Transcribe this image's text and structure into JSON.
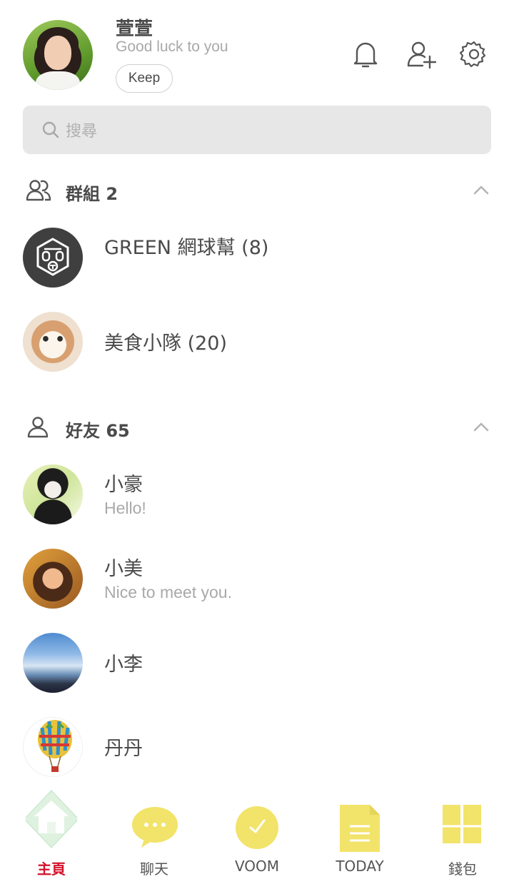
{
  "profile": {
    "name": "萱萱",
    "status_message": "Good luck to you",
    "keep_label": "Keep"
  },
  "header_icons": [
    "bell-icon",
    "add-friend-icon",
    "settings-gear-icon"
  ],
  "search": {
    "placeholder": "搜尋"
  },
  "groups": {
    "title": "群組 2",
    "items": [
      {
        "name": "GREEN 網球幫 (8)"
      },
      {
        "name": "美食小隊 (20)"
      }
    ]
  },
  "friends": {
    "title": "好友 65",
    "items": [
      {
        "name": "小豪",
        "status": "Hello!"
      },
      {
        "name": "小美",
        "status": "Nice to meet you."
      },
      {
        "name": "小李",
        "status": ""
      },
      {
        "name": "丹丹",
        "status": ""
      }
    ]
  },
  "bottom_nav": {
    "items": [
      {
        "label": "主頁",
        "icon": "home-icon",
        "active": true
      },
      {
        "label": "聊天",
        "icon": "chat-bubble-icon",
        "active": false
      },
      {
        "label": "VOOM",
        "icon": "clock-icon",
        "active": false
      },
      {
        "label": "TODAY",
        "icon": "news-document-icon",
        "active": false
      },
      {
        "label": "錢包",
        "icon": "wallet-grid-icon",
        "active": false
      }
    ]
  },
  "colors": {
    "active_nav": "#d3122a",
    "icon_yellow": "#f2e36a",
    "search_bg": "#e7e7e7"
  }
}
